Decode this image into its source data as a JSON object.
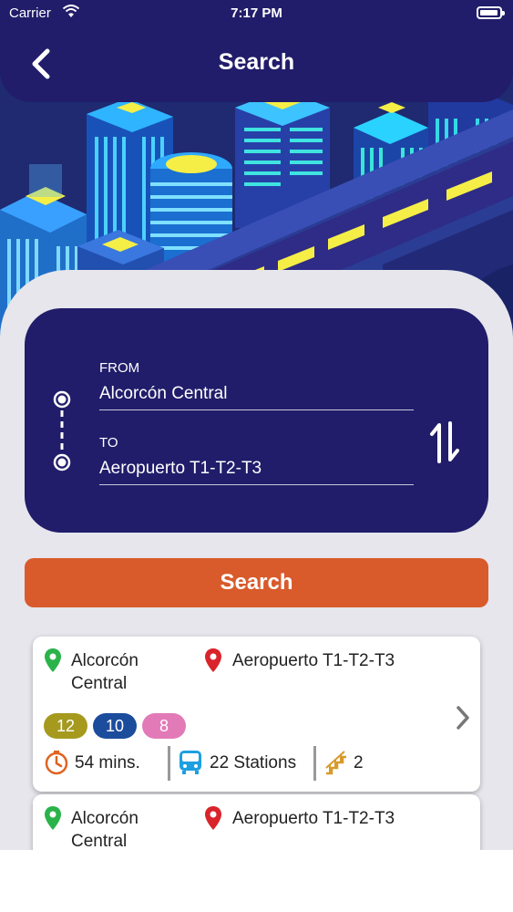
{
  "status_bar": {
    "carrier": "Carrier",
    "time": "7:17 PM"
  },
  "header": {
    "title": "Search"
  },
  "route_form": {
    "from_label": "FROM",
    "from_value": "Alcorcón Central",
    "to_label": "TO",
    "to_value": "Aeropuerto T1-T2-T3"
  },
  "search_button": {
    "label": "Search"
  },
  "results": [
    {
      "origin": "Alcorcón Central",
      "destination": "Aeropuerto T1-T2-T3",
      "lines": [
        {
          "label": "12",
          "color": "#a59a1e"
        },
        {
          "label": "10",
          "color": "#1c4c9c"
        },
        {
          "label": "8",
          "color": "#e27ab8"
        }
      ],
      "duration": "54 mins.",
      "stations": "22 Stations",
      "transfers": "2"
    },
    {
      "origin": "Alcorcón Central",
      "destination": "Aeropuerto T1-T2-T3"
    }
  ],
  "icons": {
    "back": "chevron-left-icon",
    "route": "route-line-icon",
    "swap": "swap-vertical-icon",
    "origin_pin": "map-pin-green-icon",
    "destination_pin": "map-pin-red-icon",
    "duration": "clock-icon",
    "stations": "bus-icon",
    "transfers": "stairs-icon",
    "more": "chevron-right-icon"
  },
  "colors": {
    "header_bg": "#211d6a",
    "card_bg": "#211d6a",
    "accent": "#d95a2b",
    "panel_bg": "#e6e6ec",
    "origin_pin": "#2bb34a",
    "destination_pin": "#d9242b",
    "clock": "#e0621e",
    "bus": "#1e9fe0",
    "stairs": "#d89a2a"
  }
}
